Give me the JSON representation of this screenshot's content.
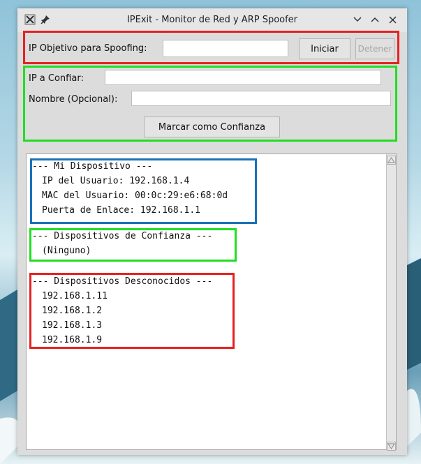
{
  "window": {
    "title": "IPExit - Monitor de Red y ARP Spoofer"
  },
  "spoof": {
    "label": "IP Objetivo para Spoofing:",
    "input_value": "",
    "start_label": "Iniciar",
    "stop_label": "Detener"
  },
  "trust": {
    "ip_label": "IP a Confiar:",
    "ip_value": "",
    "name_label": "Nombre (Opcional):",
    "name_value": "",
    "mark_label": "Marcar como Confianza"
  },
  "output": {
    "my_device": {
      "header": "--- Mi Dispositivo ---",
      "lines": [
        "IP del Usuario: 192.168.1.4",
        "MAC del Usuario: 00:0c:29:e6:68:0d",
        "Puerta de Enlace: 192.168.1.1"
      ]
    },
    "trusted": {
      "header": "--- Dispositivos de Confianza ---",
      "lines": [
        "(Ninguno)"
      ]
    },
    "unknown": {
      "header": "--- Dispositivos Desconocidos ---",
      "lines": [
        "192.168.1.11",
        "192.168.1.2",
        "192.168.1.3",
        "192.168.1.9"
      ]
    }
  },
  "colors": {
    "highlight_red": "#e82020",
    "highlight_green": "#22dd22",
    "highlight_blue": "#1a72b8"
  }
}
